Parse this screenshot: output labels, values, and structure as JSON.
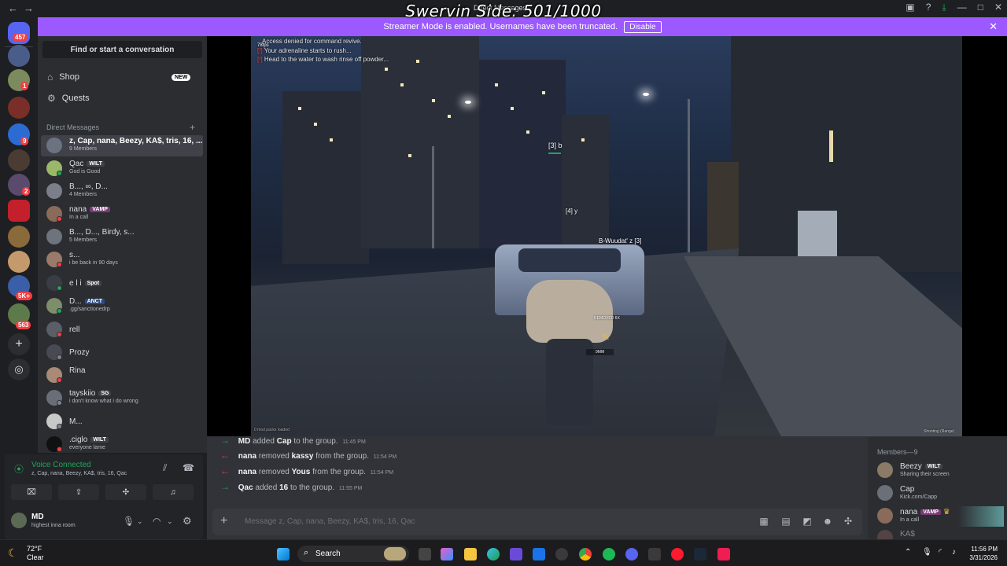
{
  "overlay_title": "Swervin Side: 501/1000",
  "window_title": "Direct Messages",
  "streamer_banner": {
    "text": "Streamer Mode is enabled. Usernames have been truncated.",
    "button": "Disable"
  },
  "rail": {
    "badges": [
      "457",
      "1",
      "9",
      "2",
      "5K+",
      "563"
    ]
  },
  "sidebar": {
    "find": "Find or start a conversation",
    "shop": "Shop",
    "shop_badge": "NEW",
    "quests": "Quests",
    "dm_header": "Direct Messages",
    "dms": [
      {
        "name": "z, Cap, nana, Beezy, KA$, tris, 16, ...",
        "sub": "9 Members",
        "selected": true
      },
      {
        "name": "Qac",
        "tag": "WILT",
        "sub": "God is Good"
      },
      {
        "name": "B..., ∞, D...",
        "sub": "4 Members"
      },
      {
        "name": "nana",
        "tag": "VAMP",
        "sub": "In a call"
      },
      {
        "name": "B..., D..., Birdy, s...",
        "sub": "5 Members"
      },
      {
        "name": "s...",
        "sub": "i be back in 90 days"
      },
      {
        "name": "e l i",
        "tag": "Spot",
        "sub": ""
      },
      {
        "name": "D...",
        "tag": "ANCT",
        "sub": ".gg/sanctionedrp"
      },
      {
        "name": "rell",
        "sub": ""
      },
      {
        "name": "Prozy",
        "sub": ""
      },
      {
        "name": "Rina",
        "sub": ""
      },
      {
        "name": "tayskiio",
        "tag": "SG",
        "sub": "i don't know what i do wrong"
      },
      {
        "name": "M...",
        "sub": ""
      },
      {
        "name": ".ciglo",
        "tag": "WILT",
        "sub": "everyone lame"
      }
    ]
  },
  "voice": {
    "status": "Voice Connected",
    "members": "z, Cap, nana, Beezy, KA$, tris, 16, Qac",
    "user": "MD",
    "user_status": "highest inna room"
  },
  "game": {
    "chat": [
      {
        "prefix": "",
        "text": "Access denied for command revive."
      },
      {
        "prefix": "[!]",
        "text": "Your adrenaline starts to rush..."
      },
      {
        "prefix": "[!]",
        "text": "Head to the water to wash rinse off powder..."
      }
    ],
    "labels": {
      "player1": "[3] b",
      "player2": "[4] y",
      "player3": "B-Wuudat' z [3]",
      "removed": "REMOVED 6X",
      "ammo": "9MM",
      "loaded": "0 mod packs loaded",
      "zone": "Shooting (Range)",
      "fps": "78fps"
    }
  },
  "messages": [
    {
      "dir": "in",
      "actor": "MD",
      "action": "added",
      "target": "Cap",
      "rest": "to the group.",
      "time": "11:45 PM"
    },
    {
      "dir": "out",
      "actor": "nana",
      "action": "removed",
      "target": "kassy",
      "rest": "from the group.",
      "time": "11:54 PM"
    },
    {
      "dir": "out",
      "actor": "nana",
      "action": "removed",
      "target": "Yous",
      "rest": "from the group.",
      "time": "11:54 PM"
    },
    {
      "dir": "in",
      "actor": "Qac",
      "action": "added",
      "target": "16",
      "rest": "to the group.",
      "time": "11:55 PM"
    }
  ],
  "composer": {
    "placeholder": "Message z, Cap, nana, Beezy, KA$, tris, 16, Qac"
  },
  "members": {
    "header": "Members—9",
    "list": [
      {
        "name": "Beezy",
        "tag": "WILT",
        "sub": "Sharing their screen"
      },
      {
        "name": "Cap",
        "sub": "Kick.com/Capp"
      },
      {
        "name": "nana",
        "tag": "VAMP",
        "sub": "In a call"
      },
      {
        "name": "KA$",
        "sub": ""
      }
    ]
  },
  "taskbar": {
    "temp": "72°F",
    "condition": "Clear",
    "search": "Search",
    "time": "11:56 PM",
    "date": "3/31/2026"
  },
  "colors": {
    "accent": "#9b59ff",
    "online": "#23a55a",
    "dnd": "#f23f43"
  }
}
